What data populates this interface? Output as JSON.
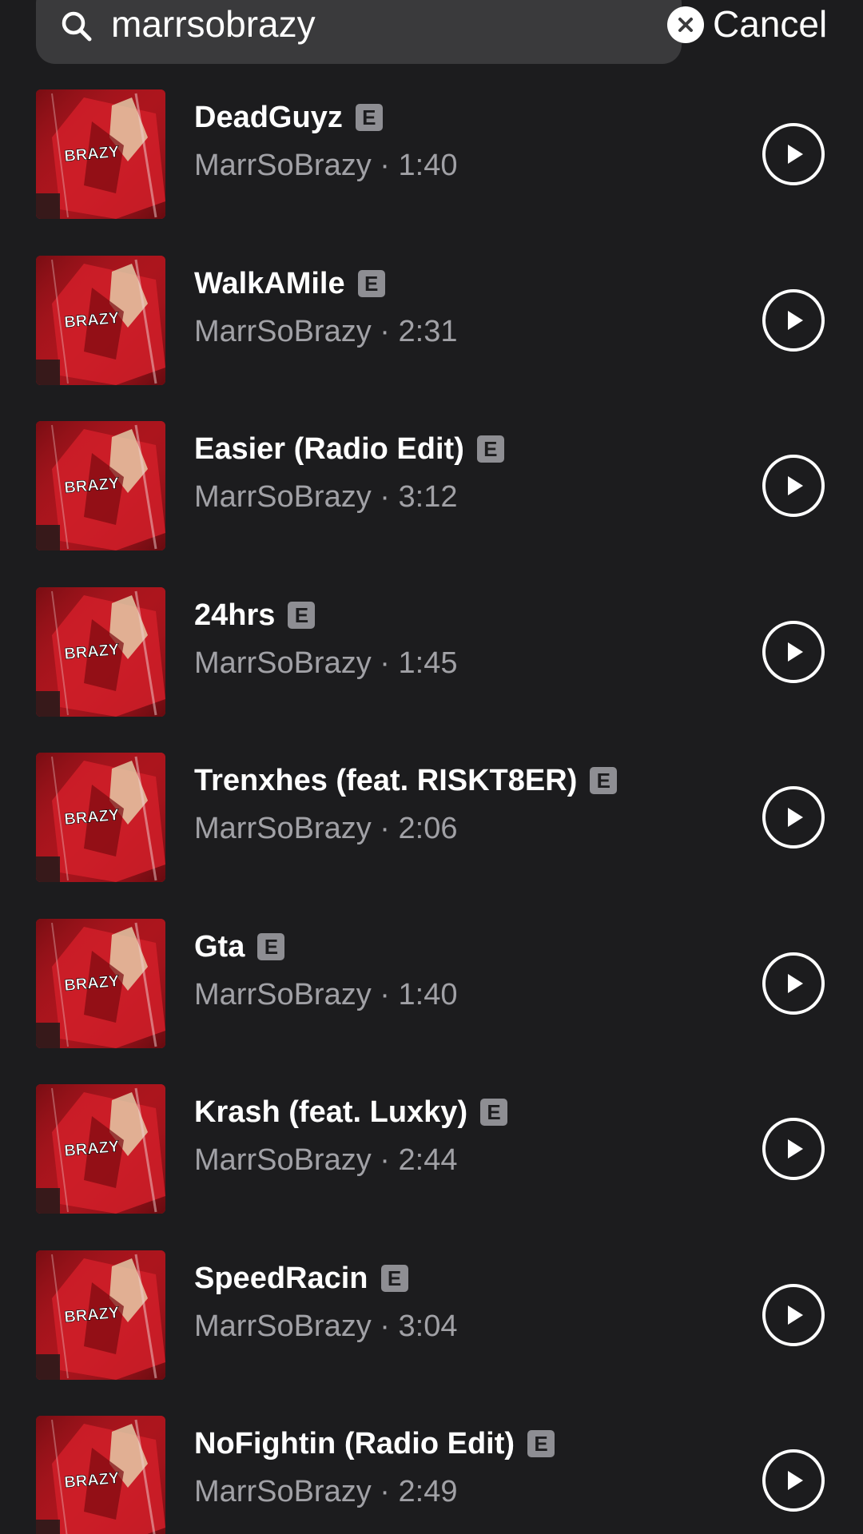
{
  "search": {
    "query": "marrsobrazy",
    "cancel_label": "Cancel"
  },
  "colors": {
    "background": "#1c1c1e",
    "search_field": "#3a3a3c",
    "secondary_text": "#a1a1a6",
    "artwork_red": "#b3141c"
  },
  "tracks": [
    {
      "title": "DeadGuyz",
      "explicit": "E",
      "artist": "MarrSoBrazy",
      "separator": "·",
      "duration": "1:40",
      "artwork_text": "BRAZY"
    },
    {
      "title": "WalkAMile",
      "explicit": "E",
      "artist": "MarrSoBrazy",
      "separator": "·",
      "duration": "2:31",
      "artwork_text": "BRAZY"
    },
    {
      "title": "Easier (Radio Edit)",
      "explicit": "E",
      "artist": "MarrSoBrazy",
      "separator": "·",
      "duration": "3:12",
      "artwork_text": "BRAZY"
    },
    {
      "title": "24hrs",
      "explicit": "E",
      "artist": "MarrSoBrazy",
      "separator": "·",
      "duration": "1:45",
      "artwork_text": "BRAZY"
    },
    {
      "title": "Trenxhes (feat. RISKT8ER)",
      "explicit": "E",
      "artist": "MarrSoBrazy",
      "separator": "·",
      "duration": "2:06",
      "artwork_text": "BRAZY"
    },
    {
      "title": "Gta",
      "explicit": "E",
      "artist": "MarrSoBrazy",
      "separator": "·",
      "duration": "1:40",
      "artwork_text": "BRAZY"
    },
    {
      "title": "Krash (feat. Luxky)",
      "explicit": "E",
      "artist": "MarrSoBrazy",
      "separator": "·",
      "duration": "2:44",
      "artwork_text": "BRAZY"
    },
    {
      "title": "SpeedRacin",
      "explicit": "E",
      "artist": "MarrSoBrazy",
      "separator": "·",
      "duration": "3:04",
      "artwork_text": "BRAZY"
    },
    {
      "title": "NoFightin (Radio Edit)",
      "explicit": "E",
      "artist": "MarrSoBrazy",
      "separator": "·",
      "duration": "2:49",
      "artwork_text": "BRAZY"
    }
  ],
  "icons": {
    "search": "search-icon",
    "clear": "clear-icon",
    "play": "play-icon",
    "artwork": "album-artwork"
  }
}
